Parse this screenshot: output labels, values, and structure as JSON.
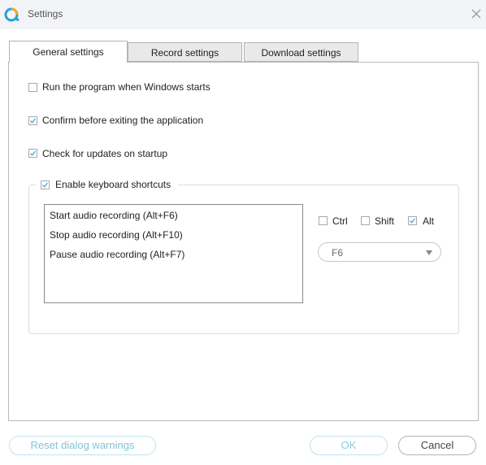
{
  "window": {
    "title": "Settings"
  },
  "tabs": [
    {
      "label": "General settings",
      "active": true
    },
    {
      "label": "Record settings",
      "active": false
    },
    {
      "label": "Download settings",
      "active": false
    }
  ],
  "general": {
    "options": [
      {
        "label": "Run the program when Windows starts",
        "checked": false
      },
      {
        "label": "Confirm before exiting the application",
        "checked": true
      },
      {
        "label": "Check for updates on startup",
        "checked": true
      }
    ],
    "shortcuts_group": {
      "label": "Enable keyboard shortcuts",
      "checked": true
    },
    "shortcut_list": [
      "Start audio recording (Alt+F6)",
      "Stop audio recording (Alt+F10)",
      "Pause audio recording (Alt+F7)"
    ],
    "modifiers": [
      {
        "label": "Ctrl",
        "checked": false
      },
      {
        "label": "Shift",
        "checked": false
      },
      {
        "label": "Alt",
        "checked": true
      }
    ],
    "key_select": {
      "value": "F6"
    }
  },
  "buttons": {
    "reset": "Reset dialog warnings",
    "ok": "OK",
    "cancel": "Cancel"
  },
  "colors": {
    "accent_blue": "#2a9fd6",
    "accent_orange": "#f5a623",
    "check": "#3a9fd8",
    "button_light_text": "#7fc4d8"
  },
  "icons": {
    "app": "app-logo-icon",
    "close": "close-icon",
    "check": "checkmark-icon",
    "dropdown": "chevron-down-icon"
  }
}
